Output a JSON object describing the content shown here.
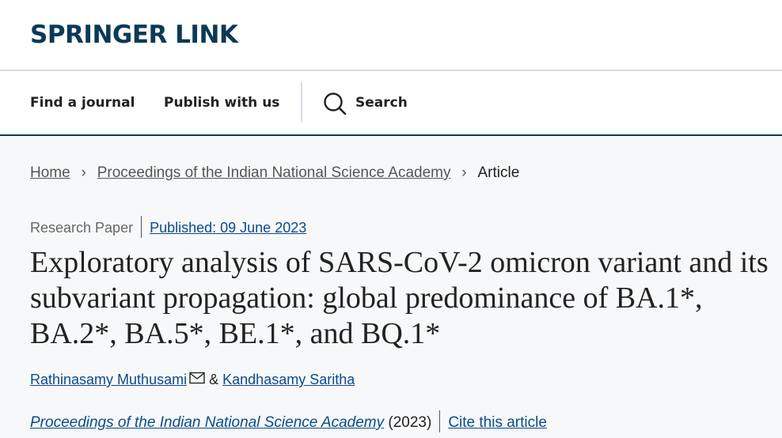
{
  "header": {
    "logo": "SPRINGER LINK"
  },
  "nav": {
    "items": [
      {
        "label": "Find a journal"
      },
      {
        "label": "Publish with us"
      }
    ],
    "search_label": "Search"
  },
  "breadcrumb": {
    "items": [
      "Home",
      "Proceedings of the Indian National Science Academy",
      "Article"
    ]
  },
  "article": {
    "type": "Research Paper",
    "published": "Published: 09 June 2023",
    "title": "Exploratory analysis of SARS-CoV-2 omicron variant and its subvariant propagation: global predominance of BA.1*, BA.2*, BA.5*, BE.1*, and BQ.1*",
    "authors": [
      "Rathinasamy Muthusami",
      "Kandhasamy Saritha"
    ],
    "author_separator": "&",
    "journal": "Proceedings of the Indian National Science Academy",
    "year": "(2023)",
    "cite_label": "Cite this article"
  },
  "colors": {
    "brand": "#0a3a57",
    "link": "#0c4b8e",
    "content_bg": "#f7f8f9"
  }
}
